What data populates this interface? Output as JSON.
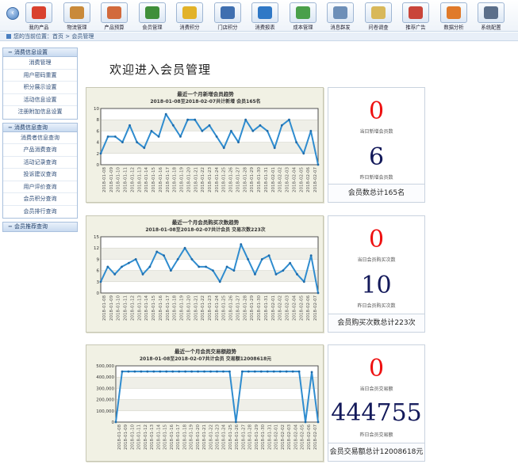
{
  "toolbar": [
    {
      "label": "我的产品",
      "icon": "shield-icon",
      "color": "#d9412e"
    },
    {
      "label": "物流管理",
      "icon": "box-icon",
      "color": "#c98a3a"
    },
    {
      "label": "产品预算",
      "icon": "mail-icon",
      "color": "#d26a3c"
    },
    {
      "label": "会员管理",
      "icon": "pie-icon",
      "color": "#3f8f3a"
    },
    {
      "label": "消费积分",
      "icon": "coins-icon",
      "color": "#e2b228"
    },
    {
      "label": "门店积分",
      "icon": "store-icon",
      "color": "#3f6fb0"
    },
    {
      "label": "消费报表",
      "icon": "table-icon",
      "color": "#2f78c6"
    },
    {
      "label": "成本管理",
      "icon": "cubes-icon",
      "color": "#4aa04a"
    },
    {
      "label": "消息群发",
      "icon": "envelope-icon",
      "color": "#6d8fb8"
    },
    {
      "label": "问卷调查",
      "icon": "note-icon",
      "color": "#d8b85a"
    },
    {
      "label": "推荐广告",
      "icon": "chart-board-icon",
      "color": "#c9453a"
    },
    {
      "label": "数据分析",
      "icon": "bar-chart-icon",
      "color": "#e07a2a"
    },
    {
      "label": "系统配置",
      "icon": "phone-icon",
      "color": "#5b6f8a"
    }
  ],
  "breadcrumb": {
    "prefix": "您的当前位置：",
    "home": "首页",
    "sep": " > ",
    "current": "会员管理"
  },
  "sidebar": {
    "groups": [
      {
        "title": "消费信息设置",
        "items": [
          "消费管理",
          "用户密码重置",
          "积分展示设置",
          "活动信息设置",
          "注册附加信息设置"
        ]
      },
      {
        "title": "消费信息查询",
        "items": [
          "消费者信息查询",
          "产品消费查询",
          "活动记录查询",
          "投诉建议查询",
          "用户评价查询",
          "会员积分查询",
          "会员排行查询"
        ]
      },
      {
        "title": "会员推荐查询",
        "items": []
      }
    ]
  },
  "welcome": "欢迎进入会员管理",
  "dates": [
    "2018-01-08",
    "2018-01-09",
    "2018-01-10",
    "2018-01-11",
    "2018-01-12",
    "2018-01-13",
    "2018-01-14",
    "2018-01-15",
    "2018-01-16",
    "2018-01-17",
    "2018-01-18",
    "2018-01-19",
    "2018-01-20",
    "2018-01-21",
    "2018-01-22",
    "2018-01-23",
    "2018-01-24",
    "2018-01-25",
    "2018-01-26",
    "2018-01-27",
    "2018-01-28",
    "2018-01-29",
    "2018-01-30",
    "2018-01-31",
    "2018-02-01",
    "2018-02-02",
    "2018-02-03",
    "2018-02-04",
    "2018-02-05",
    "2018-02-06",
    "2018-02-07"
  ],
  "stats": [
    {
      "today": "0",
      "today_label": "当日新增会员数",
      "yesterday": "6",
      "yesterday_label": "昨日新增会员数",
      "total": "会员数总计165名"
    },
    {
      "today": "0",
      "today_label": "当日会员购买次数",
      "yesterday": "10",
      "yesterday_label": "昨日会员购买次数",
      "total": "会员购买次数总计223次"
    },
    {
      "today": "0",
      "today_label": "当日会员交易额",
      "yesterday": "444755",
      "yesterday_label": "昨日会员交易额",
      "total": "会员交易额总计12008618元"
    }
  ],
  "chart_data": [
    {
      "type": "line",
      "title": "最近一个月新增会员趋势",
      "subtitle": "2018-01-08至2018-02-07共计新增 会员165名",
      "ylim": [
        0,
        10
      ],
      "yticks": [
        0,
        2,
        4,
        6,
        8,
        10
      ],
      "grid": true,
      "values": [
        2,
        5,
        5,
        4,
        7,
        4,
        3,
        6,
        5,
        9,
        7,
        5,
        8,
        8,
        6,
        7,
        5,
        3,
        6,
        4,
        8,
        6,
        7,
        6,
        3,
        7,
        8,
        4,
        2,
        6,
        0
      ]
    },
    {
      "type": "line",
      "title": "最近一个月会员购买次数趋势",
      "subtitle": "2018-01-08至2018-02-07共计会员 交易次数223次",
      "ylim": [
        0,
        15
      ],
      "yticks": [
        0,
        3,
        6,
        9,
        12,
        15
      ],
      "grid": true,
      "values": [
        3,
        7,
        5,
        7,
        8,
        9,
        5,
        7,
        11,
        10,
        6,
        9,
        12,
        9,
        7,
        7,
        6,
        3,
        7,
        6,
        13,
        9,
        5,
        9,
        10,
        5,
        6,
        8,
        5,
        3,
        10,
        0
      ]
    },
    {
      "type": "line",
      "title": "最近一个月会员交易额趋势",
      "subtitle": "2018-01-08至2018-02-07共计会员 交易额12008618元",
      "ylim": [
        0,
        500000
      ],
      "yticks": [
        0,
        100000,
        200000,
        300000,
        400000,
        500000
      ],
      "ytick_labels": [
        "0",
        "100,000",
        "200,000",
        "300,000",
        "400,000",
        "500,000"
      ],
      "grid": true,
      "values": [
        0,
        450000,
        450000,
        450000,
        450000,
        450000,
        450000,
        450000,
        450000,
        450000,
        450000,
        450000,
        450000,
        450000,
        450000,
        450000,
        450000,
        450000,
        450000,
        0,
        450000,
        450000,
        450000,
        450000,
        450000,
        450000,
        450000,
        450000,
        450000,
        450000,
        0,
        444755,
        0
      ]
    }
  ]
}
